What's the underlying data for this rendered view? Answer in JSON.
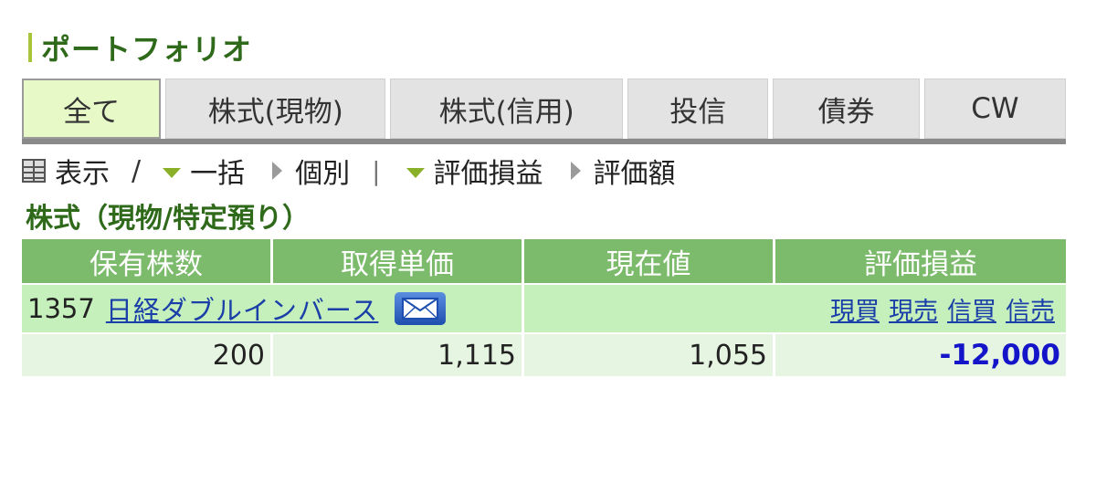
{
  "header": {
    "title": "ポートフォリオ"
  },
  "tabs": [
    {
      "label": "全て",
      "active": true
    },
    {
      "label": "株式(現物)",
      "active": false
    },
    {
      "label": "株式(信用)",
      "active": false
    },
    {
      "label": "投信",
      "active": false
    },
    {
      "label": "債券",
      "active": false
    },
    {
      "label": "CW",
      "active": false
    }
  ],
  "controls": {
    "display_label": "表示",
    "slash": "/",
    "bulk_label": "一括",
    "individual_label": "個別",
    "divider": "|",
    "pl_label": "評価損益",
    "value_label": "評価額",
    "icons": [
      "table-icon",
      "triangle-down-icon",
      "triangle-right-icon"
    ]
  },
  "section": {
    "title": "株式（現物/特定預り）"
  },
  "table": {
    "columns": [
      "保有株数",
      "取得単価",
      "現在値",
      "評価損益"
    ],
    "rows": [
      {
        "code": "1357",
        "name": "日経ダブルインバース",
        "actions": [
          "現買",
          "現売",
          "信買",
          "信売"
        ],
        "shares": "200",
        "acquisition_price": "1,115",
        "current_price": "1,055",
        "profit_loss": "-12,000"
      }
    ]
  },
  "colors": {
    "title_green": "#2e6a1a",
    "accent_bar": "#a8c43a",
    "header_green": "#7cba6c",
    "name_row_bg": "#c5efbb",
    "value_row_bg": "#e6f5e2",
    "link_blue": "#1a3fa8",
    "negative_blue": "#1414c8"
  }
}
